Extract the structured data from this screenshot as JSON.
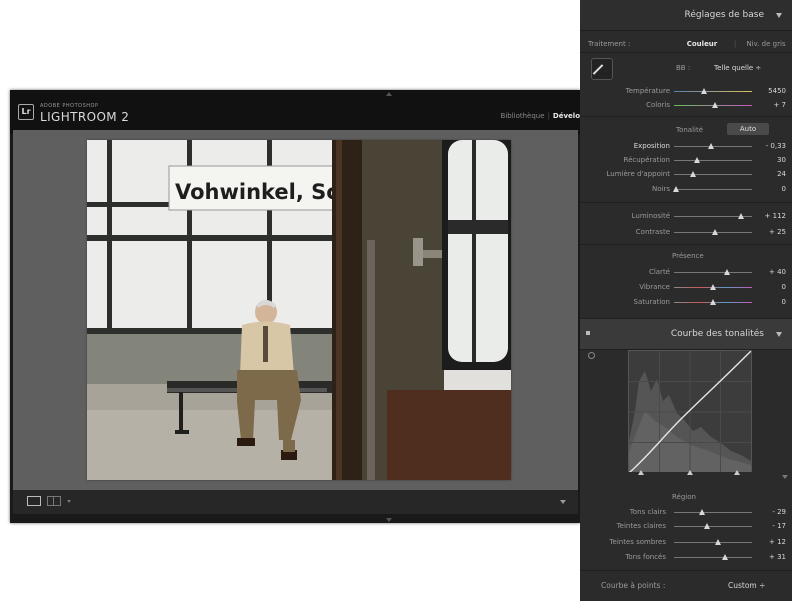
{
  "lightroom": {
    "logo": "Lr",
    "brand_small": "ADOBE PHOTOSHOP",
    "brand_big": "LIGHTROOM 2",
    "modules": [
      "Bibliothèque",
      "Dévelo"
    ]
  },
  "photo": {
    "sign_text": "Vohwinkel, Sch"
  },
  "basic": {
    "title": "Réglages de base",
    "treatment_label": "Traitement :",
    "tab_color": "Couleur",
    "tab_bw": "Niv. de gris",
    "wb_label": "BB :",
    "wb_value": "Telle quelle ÷",
    "tone_label": "Tonalité",
    "auto_label": "Auto",
    "presence_label": "Présence",
    "sliders": [
      {
        "label": "Température",
        "value": "5450",
        "pos": 0.38
      },
      {
        "label": "Coloris",
        "value": "+ 7",
        "pos": 0.52
      },
      {
        "label": "Exposition",
        "value": "- 0,33",
        "pos": 0.47
      },
      {
        "label": "Récupération",
        "value": "30",
        "pos": 0.3
      },
      {
        "label": "Lumière d'appoint",
        "value": "24",
        "pos": 0.24
      },
      {
        "label": "Noirs",
        "value": "0",
        "pos": 0.03
      },
      {
        "label": "Luminosité",
        "value": "+ 112",
        "pos": 0.86
      },
      {
        "label": "Contraste",
        "value": "+ 25",
        "pos": 0.52
      },
      {
        "label": "Clarté",
        "value": "+ 40",
        "pos": 0.68
      },
      {
        "label": "Vibrance",
        "value": "0",
        "pos": 0.5
      },
      {
        "label": "Saturation",
        "value": "0",
        "pos": 0.5
      }
    ]
  },
  "curve": {
    "title": "Courbe des tonalités",
    "region_label": "Région",
    "point_curve_label": "Courbe à points :",
    "point_curve_value": "Custom ÷",
    "sliders": [
      {
        "label": "Tons clairs",
        "value": "- 29",
        "pos": 0.36
      },
      {
        "label": "Teintes claires",
        "value": "- 17",
        "pos": 0.42
      },
      {
        "label": "Teintes sombres",
        "value": "+ 12",
        "pos": 0.56
      },
      {
        "label": "Tons foncés",
        "value": "+ 31",
        "pos": 0.66
      }
    ]
  },
  "colors": {
    "panel_bg": "#2b2b2b",
    "canvas_bg": "#5f5f5f",
    "label": "#9a9a9a",
    "value": "#d9d9d9"
  }
}
